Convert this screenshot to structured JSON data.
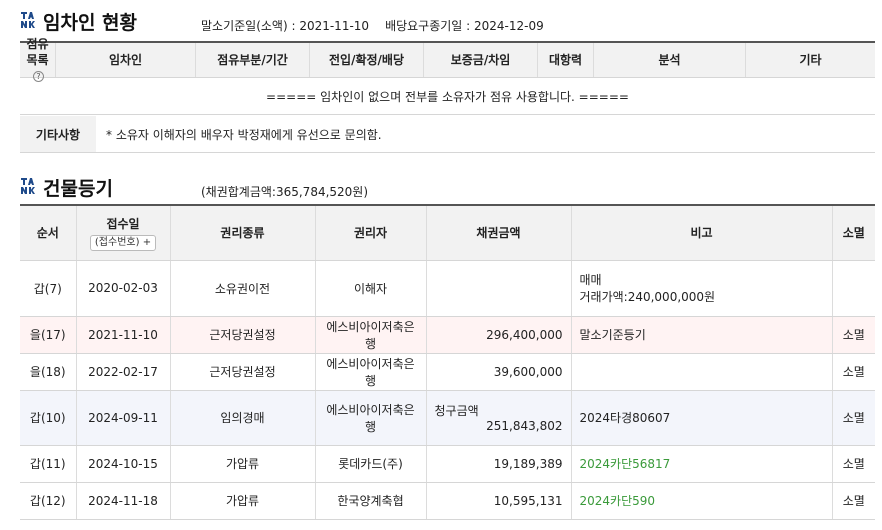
{
  "tenant_section": {
    "title": "임차인 현황",
    "base_date": "말소기준일(소액) : 2021-11-10",
    "deadline": "배당요구종기일 : 2024-12-09",
    "columns": {
      "occupancy_list_1": "점유",
      "occupancy_list_2": "목록",
      "help": "?",
      "tenant": "임차인",
      "occupancy_part": "점유부분/기간",
      "registration": "전입/확정/배당",
      "deposit": "보증금/차임",
      "opposing_power": "대항력",
      "analysis": "분석",
      "other": "기타"
    },
    "empty_message": "===== 임차인이 없으며 전부를 소유자가 점유 사용합니다. =====",
    "notes_label": "기타사항",
    "notes_text": "* 소유자 이해자의 배우자 박정재에게 유선으로 문의함."
  },
  "registry_section": {
    "title": "건물등기",
    "total_claim": "(채권합계금액:365,784,520원)",
    "columns": {
      "order": "순서",
      "receipt_date": "접수일",
      "receipt_no_button": "(접수번호) +",
      "right_type": "권리종류",
      "right_holder": "권리자",
      "claim_amount": "채권금액",
      "remarks": "비고",
      "extinction": "소멸"
    },
    "rows": [
      {
        "order": "갑(7)",
        "date": "2020-02-03",
        "type": "소유권이전",
        "holder": "이해자",
        "amount": "",
        "remark_1": "매매",
        "remark_2": "거래가액:240,000,000원",
        "ext": ""
      },
      {
        "order": "을(17)",
        "date": "2021-11-10",
        "type": "근저당권설정",
        "holder": "에스비아이저축은행",
        "amount": "296,400,000",
        "remark_1": "말소기준등기",
        "remark_2": "",
        "ext": "소멸"
      },
      {
        "order": "을(18)",
        "date": "2022-02-17",
        "type": "근저당권설정",
        "holder": "에스비아이저축은행",
        "amount": "39,600,000",
        "remark_1": "",
        "remark_2": "",
        "ext": "소멸"
      },
      {
        "order": "갑(10)",
        "date": "2024-09-11",
        "type": "임의경매",
        "holder": "에스비아이저축은행",
        "amount_label": "청구금액",
        "amount": "251,843,802",
        "remark_1": "2024타경80607",
        "remark_2": "",
        "ext": "소멸"
      },
      {
        "order": "갑(11)",
        "date": "2024-10-15",
        "type": "가압류",
        "holder": "롯데카드(주)",
        "amount": "19,189,389",
        "remark_1": "2024카단56817",
        "remark_2": "",
        "ext": "소멸"
      },
      {
        "order": "갑(12)",
        "date": "2024-11-18",
        "type": "가압류",
        "holder": "한국양계축협",
        "amount": "10,595,131",
        "remark_1": "2024카단590",
        "remark_2": "",
        "ext": "소멸"
      }
    ]
  },
  "colors": {
    "link_green": "#3a9a3a",
    "logo_blue": "#1f4a8a",
    "pink_row": "#fff3f3",
    "blue_row": "#f3f5fb"
  },
  "icons": {
    "logo": "tank-logo-icon",
    "help": "question-circle-icon",
    "plus": "plus-icon"
  }
}
